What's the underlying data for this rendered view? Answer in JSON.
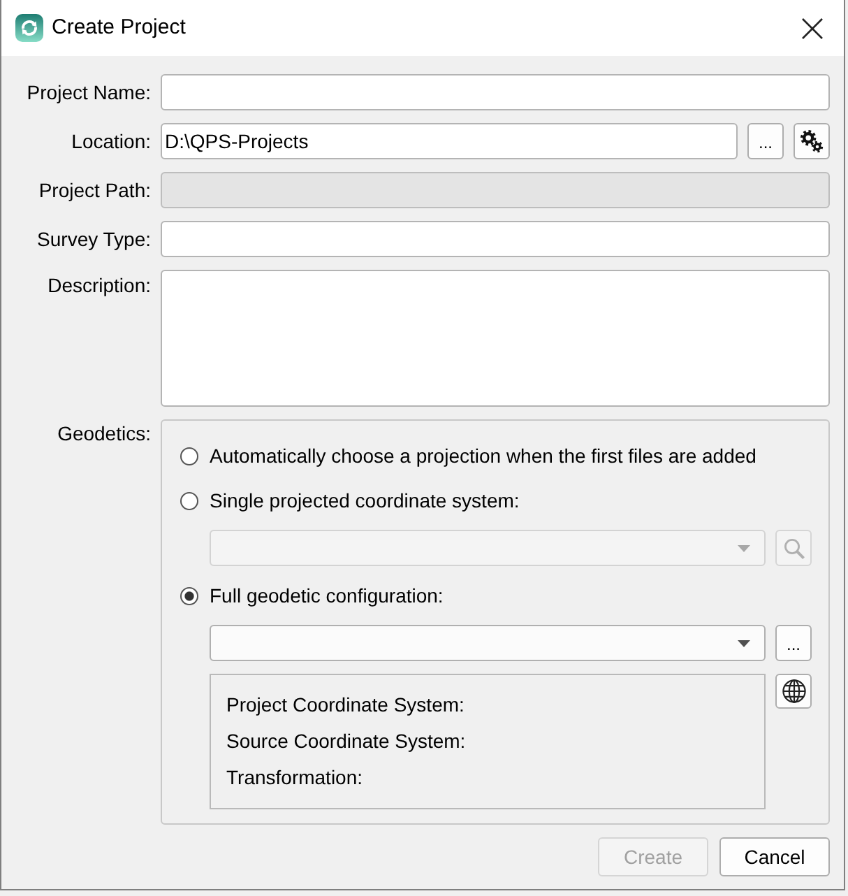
{
  "window": {
    "title": "Create Project"
  },
  "fields": [
    {
      "kind": "text",
      "label": "Project Name:",
      "disabled": false
    },
    {
      "kind": "path",
      "label": "Location:",
      "value": "D:\\QPS-Projects",
      "disabled": false,
      "browse_button": "..."
    },
    {
      "kind": "text",
      "label": "Project Path:",
      "disabled": true
    },
    {
      "kind": "text",
      "label": "Survey Type:",
      "disabled": false
    },
    {
      "kind": "multiline",
      "label": "Description:",
      "disabled": false
    }
  ],
  "geodetics": {
    "label": "Geodetics:",
    "options": [
      {
        "kind": "plain",
        "label": "Automatically choose a projection when the first files are added",
        "selected": false
      },
      {
        "kind": "search",
        "label": "Single projected coordinate system:",
        "selected": false
      },
      {
        "kind": "browse",
        "label": "Full geodetic configuration:",
        "selected": true,
        "browse_button": "..."
      }
    ],
    "summary": [
      "Project Coordinate System:",
      "Source Coordinate System:",
      "Transformation:"
    ]
  },
  "buttons": [
    {
      "label": "Create",
      "disabled": true
    },
    {
      "label": "Cancel",
      "disabled": false
    }
  ]
}
